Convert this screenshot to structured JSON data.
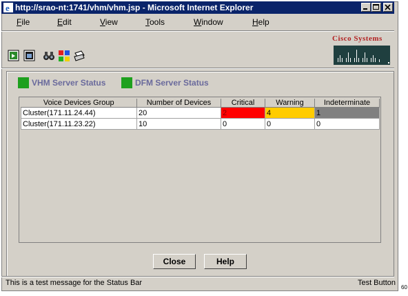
{
  "window": {
    "title": "http://srao-nt:1741/vhm/vhm.jsp - Microsoft Internet Explorer"
  },
  "menu": {
    "items": [
      {
        "first": "F",
        "rest": "ile"
      },
      {
        "first": "E",
        "rest": "dit"
      },
      {
        "first": "V",
        "rest": "iew"
      },
      {
        "first": "T",
        "rest": "ools"
      },
      {
        "first": "W",
        "rest": "indow"
      },
      {
        "first": "H",
        "rest": "elp"
      }
    ]
  },
  "toolbar": {
    "buttons": [
      "refresh-icon",
      "window-icon",
      "binoculars-icon",
      "color-grid-icon",
      "print-icon"
    ]
  },
  "logo": {
    "text": "Cisco Systems"
  },
  "status_tabs": [
    {
      "label": "VHM Server Status",
      "color": "#1ea01e"
    },
    {
      "label": "DFM Server Status",
      "color": "#1ea01e"
    }
  ],
  "table": {
    "columns": [
      "Voice Devices Group",
      "Number of Devices",
      "Critical",
      "Warning",
      "Indeterminate"
    ],
    "rows": [
      {
        "group": "Cluster(171.11.24.44)",
        "devices": "20",
        "critical": "2",
        "warning": "4",
        "indeterminate": "1"
      },
      {
        "group": "Cluster(171.11.23.22)",
        "devices": "10",
        "critical": "0",
        "warning": "0",
        "indeterminate": "0"
      }
    ]
  },
  "buttons": {
    "close": "Close",
    "help": "Help"
  },
  "statusbar": {
    "message": "This is a test message for the Status Bar",
    "button": "Test Button"
  },
  "page_mark": "60",
  "colors": {
    "titlebar": "#0a246a",
    "critical": "#ff0000",
    "warning": "#ffcc00",
    "indeterminate": "#808080",
    "status_ok": "#1ea01e"
  }
}
